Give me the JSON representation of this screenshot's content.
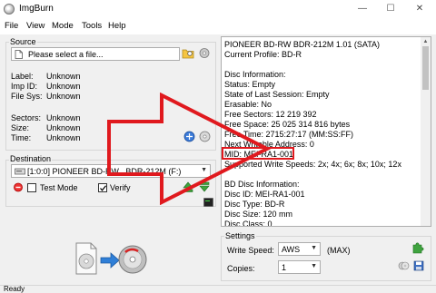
{
  "window": {
    "title": "ImgBurn"
  },
  "menu": [
    "File",
    "View",
    "Mode",
    "Tools",
    "Help"
  ],
  "source": {
    "title": "Source",
    "placeholder": "Please select a file...",
    "labels": [
      "Label:",
      "Imp ID:",
      "File Sys:"
    ],
    "values": [
      "Unknown",
      "Unknown",
      "Unknown"
    ],
    "labels2": [
      "Sectors:",
      "Size:",
      "Time:"
    ],
    "values2": [
      "Unknown",
      "Unknown",
      "Unknown"
    ]
  },
  "destination": {
    "title": "Destination",
    "device": "[1:0:0] PIONEER BD-RW   BDR-212M (F:)",
    "test_mode_label": "Test Mode",
    "verify_label": "Verify",
    "test_mode_checked": false,
    "verify_checked": true
  },
  "info": {
    "lines": [
      "PIONEER BD-RW   BDR-212M 1.01 (SATA)",
      "Current Profile: BD-R",
      "",
      "Disc Information:",
      "Status: Empty",
      "State of Last Session: Empty",
      "Erasable: No",
      "Free Sectors: 12 219 392",
      "Free Space: 25 025 314 816 bytes",
      "Free Time: 2715:27:17 (MM:SS:FF)",
      "Next Writable Address: 0",
      "MID: MEI-RA1-001",
      "Supported Write Speeds: 2x; 4x; 6x; 8x; 10x; 12x",
      "",
      "BD Disc Information:",
      "Disc ID: MEI-RA1-001",
      "Disc Type: BD-R",
      "Disc Size: 120 mm",
      "Disc Class: 0"
    ]
  },
  "settings": {
    "title": "Settings",
    "write_speed_label": "Write Speed:",
    "write_speed_value": "AWS",
    "max_label": "(MAX)",
    "copies_label": "Copies:",
    "copies_value": "1"
  },
  "status": {
    "text": "Ready"
  },
  "colors": {
    "annotation": "#e0191e",
    "highlight": "#e0191e"
  }
}
